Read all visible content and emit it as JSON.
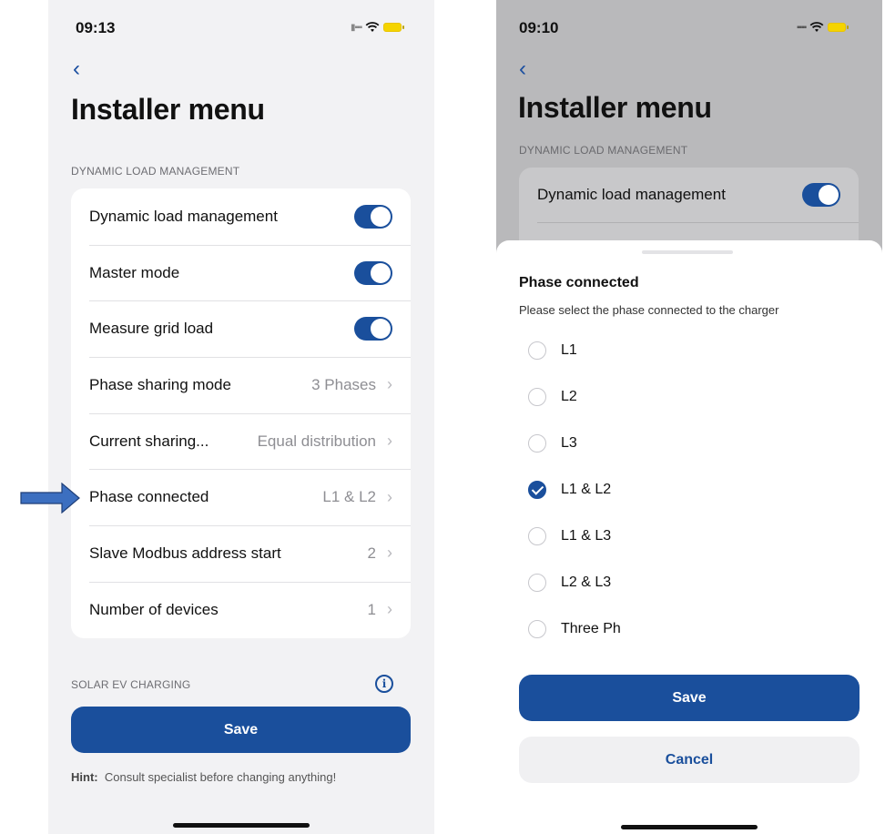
{
  "left_screen": {
    "status": {
      "time": "09:13"
    },
    "title": "Installer menu",
    "section_dlm": "DYNAMIC LOAD MANAGEMENT",
    "rows": [
      {
        "label": "Dynamic load management",
        "toggle": true
      },
      {
        "label": "Master mode",
        "toggle": true
      },
      {
        "label": "Measure grid load",
        "toggle": true
      },
      {
        "label": "Phase sharing mode",
        "value": "3 Phases"
      },
      {
        "label": "Current sharing...",
        "value": "Equal distribution"
      },
      {
        "label": "Phase connected",
        "value": "L1 & L2"
      },
      {
        "label": "Slave Modbus address start",
        "value": "2"
      },
      {
        "label": "Number of devices",
        "value": "1"
      }
    ],
    "section_solar": "SOLAR EV CHARGING",
    "save_label": "Save",
    "hint_prefix": "Hint:",
    "hint_text": "Consult specialist before changing anything!"
  },
  "right_screen": {
    "status": {
      "time": "09:10"
    },
    "title": "Installer menu",
    "section_dlm": "DYNAMIC LOAD MANAGEMENT",
    "row_dlm_label": "Dynamic load management",
    "sheet": {
      "title": "Phase connected",
      "subtitle": "Please select the phase connected to the charger",
      "options": [
        "L1",
        "L2",
        "L3",
        "L1 & L2",
        "L1 & L3",
        "L2 & L3",
        "Three Ph"
      ],
      "selected_option": "L1 & L2",
      "save_label": "Save",
      "cancel_label": "Cancel"
    }
  },
  "colors": {
    "accent": "#1a4f9c",
    "background": "#f2f2f4",
    "annotation_arrow": "#3c6fc0"
  },
  "icons": [
    "back-chevron-icon",
    "wifi-icon",
    "battery-icon",
    "info-icon",
    "chevron-right-icon",
    "radio-check-icon",
    "annotation-arrow-icon"
  ]
}
